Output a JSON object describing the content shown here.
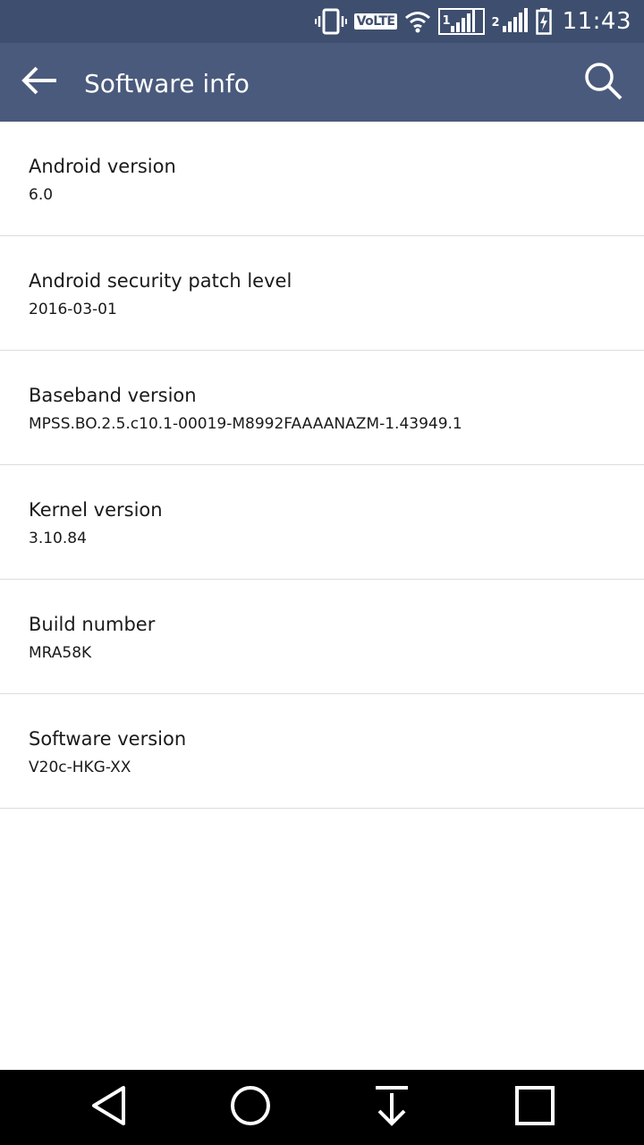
{
  "status_bar": {
    "volte_label": "VoLTE",
    "sim1_label": "1",
    "sim2_label": "2",
    "time": "11:43",
    "icons": [
      "vibrate-icon",
      "volte-icon",
      "wifi-icon",
      "signal-sim1-icon",
      "signal-sim2-icon",
      "battery-charging-icon"
    ]
  },
  "app_bar": {
    "title": "Software info",
    "back_icon": "arrow-left-icon",
    "search_icon": "search-icon"
  },
  "items": [
    {
      "title": "Android version",
      "value": "6.0"
    },
    {
      "title": "Android security patch level",
      "value": "2016-03-01"
    },
    {
      "title": "Baseband version",
      "value": "MPSS.BO.2.5.c10.1-00019-M8992FAAAANAZM-1.43949.1"
    },
    {
      "title": "Kernel version",
      "value": "3.10.84"
    },
    {
      "title": "Build number",
      "value": "MRA58K"
    },
    {
      "title": "Software version",
      "value": "V20c-HKG-XX"
    }
  ],
  "nav_bar": {
    "buttons": [
      "back-triangle-icon",
      "home-circle-icon",
      "notification-pull-icon",
      "recents-square-icon"
    ]
  },
  "colors": {
    "status_bar": "#3e4e6e",
    "app_bar": "#4a5a7c",
    "nav_bar": "#000000",
    "divider": "#dcdcdc"
  }
}
